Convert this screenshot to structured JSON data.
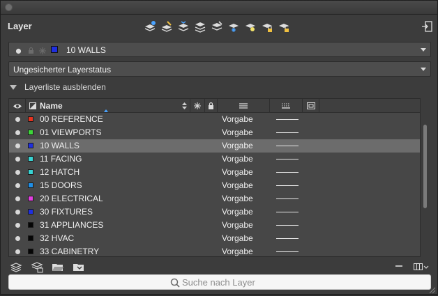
{
  "header": {
    "title": "Layer",
    "toolbar_icons": [
      "new-layer-icon",
      "new-layer-vp-frozen-icon",
      "layer-merge-icon",
      "layer-isolate-icon",
      "layer-unisolate-icon",
      "freeze-layer-icon",
      "turn-off-layer-icon",
      "lock-layer-icon",
      "unlock-layer-icon"
    ]
  },
  "current_layer": {
    "name": "10 WALLS",
    "color": "#1f2fe0"
  },
  "layer_state": {
    "value": "Ungesicherter Layerstatus"
  },
  "layer_list_toggle": {
    "label": "Layerliste ausblenden"
  },
  "table": {
    "columns": {
      "name": "Name"
    },
    "rows": [
      {
        "name": "00 REFERENCE",
        "color": "#e8321e",
        "linetype": "Vorgabe",
        "selected": false
      },
      {
        "name": "01 VIEWPORTS",
        "color": "#3ed63a",
        "linetype": "Vorgabe",
        "selected": false
      },
      {
        "name": "10 WALLS",
        "color": "#1f2fe0",
        "linetype": "Vorgabe",
        "selected": true
      },
      {
        "name": "11 FACING",
        "color": "#38d3d3",
        "linetype": "Vorgabe",
        "selected": false
      },
      {
        "name": "12 HATCH",
        "color": "#38d3d3",
        "linetype": "Vorgabe",
        "selected": false
      },
      {
        "name": "15 DOORS",
        "color": "#1f8ee6",
        "linetype": "Vorgabe",
        "selected": false
      },
      {
        "name": "20 ELECTRICAL",
        "color": "#e23ee0",
        "linetype": "Vorgabe",
        "selected": false
      },
      {
        "name": "30 FIXTURES",
        "color": "#1f2fe0",
        "linetype": "Vorgabe",
        "selected": false
      },
      {
        "name": "31 APPLIANCES",
        "color": "#050505",
        "linetype": "Vorgabe",
        "selected": false
      },
      {
        "name": "32 HVAC",
        "color": "#050505",
        "linetype": "Vorgabe",
        "selected": false
      },
      {
        "name": "33 CABINETRY",
        "color": "#050505",
        "linetype": "Vorgabe",
        "selected": false
      }
    ]
  },
  "search": {
    "placeholder": "Suche nach Layer"
  },
  "colors": {
    "accent": "#4aa3ff",
    "panel": "#3c3c3c",
    "selected_row": "#6c6c6c"
  }
}
